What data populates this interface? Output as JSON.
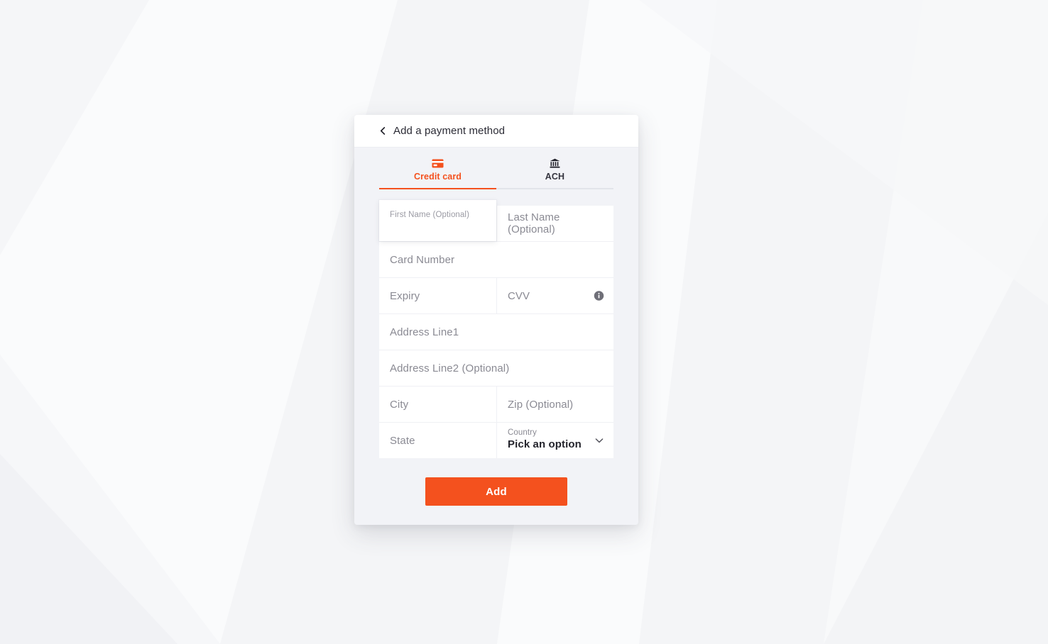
{
  "page": {
    "background_color": "#f8f9fa",
    "accent_color": "#f4511e"
  },
  "card": {
    "header": {
      "back_icon": "chevron-left-icon",
      "title": "Add a payment method"
    },
    "tabs": [
      {
        "id": "credit-card",
        "label": "Credit card",
        "icon": "credit-card-icon",
        "active": true
      },
      {
        "id": "ach",
        "label": "ACH",
        "icon": "bank-icon",
        "active": false
      }
    ],
    "form": {
      "rows": [
        {
          "fields": [
            {
              "name": "first-name",
              "placeholder": "First Name (Optional)",
              "value": "",
              "state": "focused",
              "width": "half"
            },
            {
              "name": "last-name",
              "placeholder": "Last Name (Optional)",
              "value": "",
              "width": "half"
            }
          ]
        },
        {
          "fields": [
            {
              "name": "card-number",
              "placeholder": "Card Number",
              "value": "",
              "width": "full"
            }
          ]
        },
        {
          "fields": [
            {
              "name": "expiry",
              "placeholder": "Expiry",
              "value": "",
              "width": "half"
            },
            {
              "name": "cvv",
              "placeholder": "CVV",
              "value": "",
              "width": "half",
              "icon": "info-icon"
            }
          ]
        },
        {
          "fields": [
            {
              "name": "address-line1",
              "placeholder": "Address Line1",
              "value": "",
              "width": "full"
            }
          ]
        },
        {
          "fields": [
            {
              "name": "address-line2",
              "placeholder": "Address Line2 (Optional)",
              "value": "",
              "width": "full"
            }
          ]
        },
        {
          "fields": [
            {
              "name": "city",
              "placeholder": "City",
              "value": "",
              "width": "half"
            },
            {
              "name": "zip",
              "placeholder": "Zip (Optional)",
              "value": "",
              "width": "half"
            }
          ]
        },
        {
          "fields": [
            {
              "name": "state",
              "placeholder": "State",
              "value": "",
              "width": "half"
            },
            {
              "name": "country",
              "type": "select",
              "label": "Country",
              "value": "Pick an option",
              "width": "half",
              "icon": "chevron-down-icon"
            }
          ]
        }
      ]
    },
    "submit": {
      "label": "Add"
    }
  }
}
